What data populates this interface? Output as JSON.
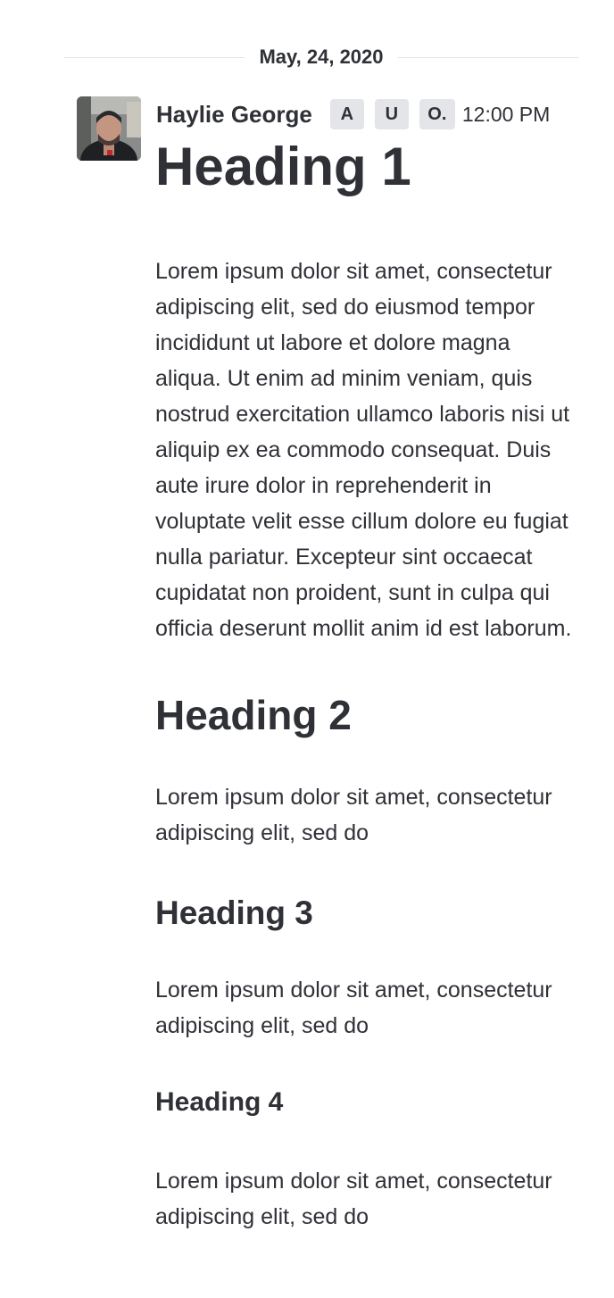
{
  "date_separator": "May, 24, 2020",
  "message": {
    "username": "Haylie George",
    "badges": [
      "A",
      "U",
      "O."
    ],
    "timestamp": "12:00 PM",
    "blocks": {
      "h1": "Heading 1",
      "p1": "Lorem ipsum dolor sit amet, consectetur adipiscing elit, sed do eiusmod tempor incididunt ut labore et dolore magna aliqua. Ut enim ad minim veniam, quis nostrud exercitation ullamco laboris nisi ut aliquip ex ea commodo consequat. Duis aute irure dolor in reprehenderit in voluptate velit esse cillum dolore eu fugiat nulla pariatur. Excepteur sint occaecat cupidatat non proident, sunt in culpa qui officia deserunt mollit anim id est laborum.",
      "h2": "Heading 2",
      "p2": "Lorem ipsum dolor sit amet, consectetur adipiscing elit, sed do",
      "h3": "Heading 3",
      "p3": "Lorem ipsum dolor sit amet, consectetur adipiscing elit, sed do",
      "h4": "Heading 4",
      "p4": "Lorem ipsum dolor sit amet, consectetur adipiscing elit, sed do"
    }
  }
}
